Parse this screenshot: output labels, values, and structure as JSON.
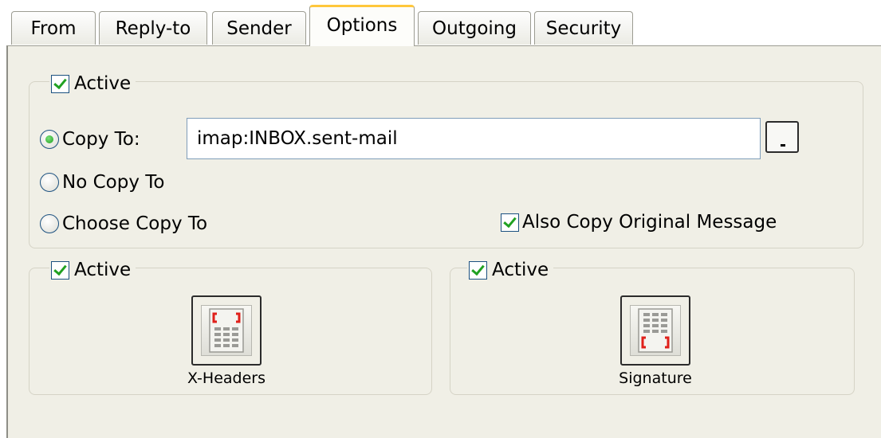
{
  "tabs": [
    "From",
    "Reply-to",
    "Sender",
    "Options",
    "Outgoing",
    "Security"
  ],
  "active_tab": "Options",
  "copy_group": {
    "active_label": "Active",
    "copy_to_label": "Copy To:",
    "copy_to_value": "imap:INBOX.sent-mail",
    "no_copy_label": "No Copy To",
    "choose_copy_label": "Choose Copy To",
    "also_copy_label": "Also Copy Original Message",
    "selected_option": "Copy To:"
  },
  "xheaders_group": {
    "active_label": "Active",
    "button_label": "X-Headers",
    "icon": "document-header-icon"
  },
  "signature_group": {
    "active_label": "Active",
    "button_label": "Signature",
    "icon": "document-signature-icon"
  },
  "colors": {
    "panel_bg": "#f0efe6",
    "active_tab_accent": "#ffc73c",
    "check_green": "#21a121",
    "icon_bracket_red": "#e0201a"
  }
}
